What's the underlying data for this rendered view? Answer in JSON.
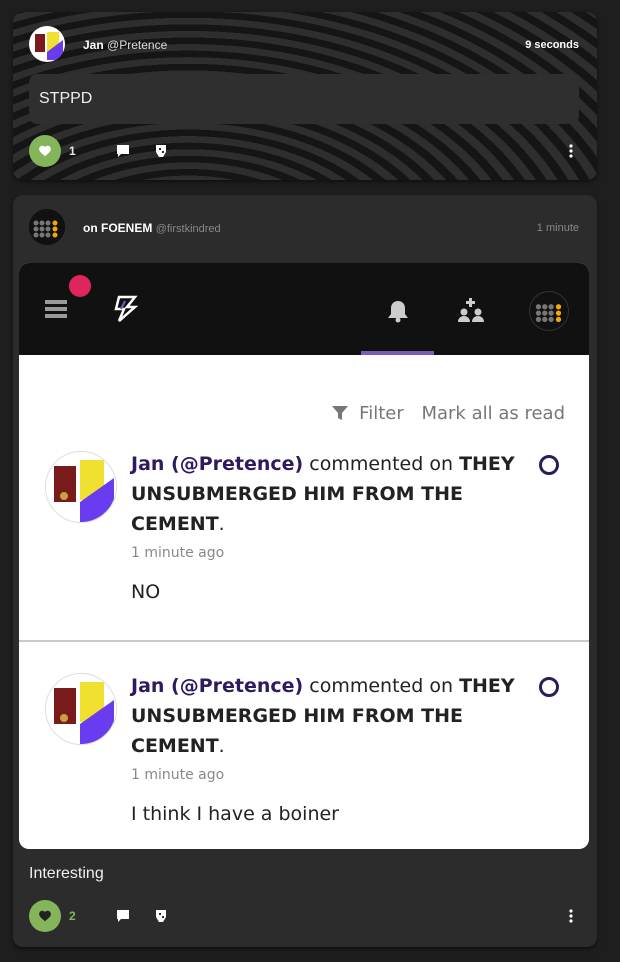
{
  "posts": [
    {
      "author": "Jan",
      "handle": "@Pretence",
      "time": "9 seconds",
      "body": "STPPD",
      "likes": "1"
    },
    {
      "prefix": "on",
      "community": "FOENEM",
      "handle": "@firstkindred",
      "time": "1 minute",
      "caption": "Interesting",
      "likes": "2",
      "screenshot": {
        "filter_label": "Filter",
        "mark_all_label": "Mark all as read",
        "notifications": [
          {
            "author": "Jan (@Pretence)",
            "action": "commented on",
            "title": "THEY UNSUBMERGED HIM FROM THE CEMENT",
            "title_end": ".",
            "time": "1 minute ago",
            "body": "NO"
          },
          {
            "author": "Jan (@Pretence)",
            "action": "commented on",
            "title": "THEY UNSUBMERGED HIM FROM THE CEMENT",
            "title_end": ".",
            "time": "1 minute ago",
            "body": "I think I have a boiner"
          }
        ]
      }
    }
  ],
  "colors": {
    "like_green": "#85b55a",
    "accent_purple": "#7b5ab8",
    "notif_dot": "#e0245e"
  }
}
